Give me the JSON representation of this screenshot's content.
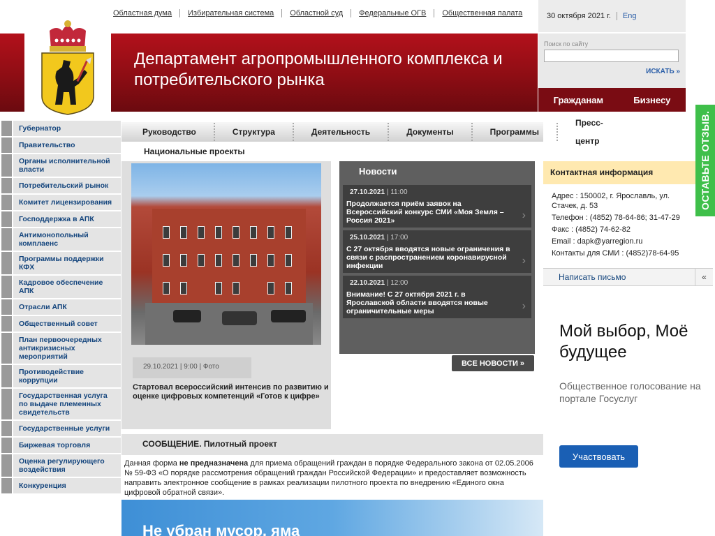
{
  "top_links": [
    "Областная дума",
    "Избирательная система",
    "Областной суд",
    "Федеральные ОГВ",
    "Общественная палата"
  ],
  "date": "30 октября 2021 г.",
  "lang": "Eng",
  "header_title": "Департамент агропромышленного комплекса и потребительского рынка",
  "search": {
    "label": "Поиск по сайту",
    "button": "ИСКАТЬ »"
  },
  "audience": [
    "Гражданам",
    "Бизнесу"
  ],
  "left_nav": [
    "Губернатор",
    "Правительство",
    "Органы исполнительной власти",
    "Потребительский рынок",
    "Комитет лицензирования",
    "Господдержка в АПК",
    "Антимонопольный комплаенс",
    "Программы поддержки КФХ",
    "Кадровое обеспечение АПК",
    "Отрасли АПК",
    "Общественный совет",
    "План первоочередных антикризисных мероприятий",
    "Противодействие коррупции",
    "Государственная услуга по выдаче племенных свидетельств",
    "Государственные услуги",
    "Биржевая торговля",
    "Оценка регулирующего воздействия",
    "Конкуренция"
  ],
  "top_menu": [
    "Руководство",
    "Структура",
    "Деятельность",
    "Документы",
    "Программы",
    "Пресс-центр"
  ],
  "submenu": "Национальные проекты",
  "featured": {
    "date": "29.10.2021",
    "time": "9:00",
    "tag": "Фото",
    "title": "Стартовал всероссийский интенсив по развитию и оценке цифровых компетенций «Готов к цифре»"
  },
  "news": {
    "title": "Новости",
    "items": [
      {
        "date": "27.10.2021",
        "time": "11:00",
        "text": "Продолжается приём заявок на Всероссийский конкурс СМИ «Моя Земля – Россия 2021»"
      },
      {
        "date": "25.10.2021",
        "time": "17:00",
        "text": "С 27 октября вводятся новые ограничения в связи с распространением коронавирусной инфекции"
      },
      {
        "date": "22.10.2021",
        "time": "12:00",
        "text": "Внимание! С 27 октября 2021 г. в Ярославской области вводятся новые ограничительные меры"
      }
    ],
    "all": "ВСЕ НОВОСТИ »"
  },
  "contact": {
    "title": "Контактная информация",
    "lines": [
      "Адрес : 150002, г. Ярославль, ул. Стачек, д. 53",
      "Телефон : (4852) 78-64-86; 31-47-29",
      "Факс : (4852) 74-62-82",
      "Email : dapk@yarregion.ru",
      "Контакты для СМИ : (4852)78-64-95"
    ],
    "write": "Написать письмо",
    "collapse": "«"
  },
  "ad": {
    "headline": "Мой выбор, Моё будущее",
    "sub": "Общественное голосование на портале Госуслуг",
    "button": "Участвовать"
  },
  "side_badge": "ОСТАВЬТЕ ОТЗЫВ.",
  "message": {
    "title": "СООБЩЕНИЕ. Пилотный проект",
    "pre": "Данная форма ",
    "bold": "не предназначена",
    "post": " для приема обращений граждан в порядке Федерального закона от 02.05.2006 № 59-ФЗ «О порядке рассмотрения обращений граждан Российской Федерации» и предоставляет возможность направить электронное сообщение в рамках реализации пилотного проекта по внедрению «Единого окна цифровой обратной связи»."
  },
  "banner": "Не убран мусор, яма"
}
